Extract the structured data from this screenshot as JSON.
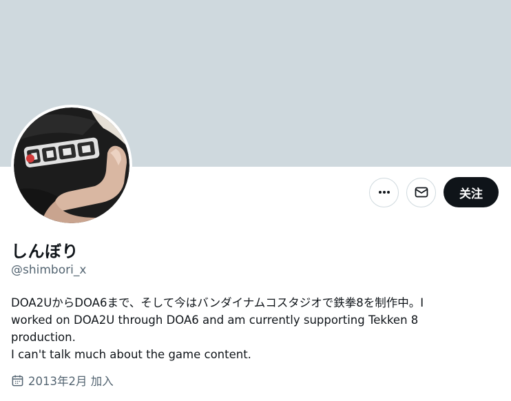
{
  "header": {
    "banner_color": "#cfd9de"
  },
  "profile": {
    "display_name": "しんぼり",
    "handle": "@shimbori_x",
    "bio_lines": [
      "DOA2UからDOA6まで、そして今はバンダイナムコスタジオで鉄拳8を制作中。I",
      "worked on DOA2U through DOA6 and am currently supporting Tekken 8",
      "production.",
      "I can't talk much about the game content."
    ],
    "joined": "2013年2月 加入"
  },
  "actions": {
    "more_icon": "more-horizontal-icon",
    "message_icon": "envelope-icon",
    "follow_label": "关注"
  },
  "colors": {
    "text_primary": "#0f1419",
    "text_secondary": "#536471",
    "border": "#cfd9de",
    "follow_bg": "#0f1419"
  }
}
